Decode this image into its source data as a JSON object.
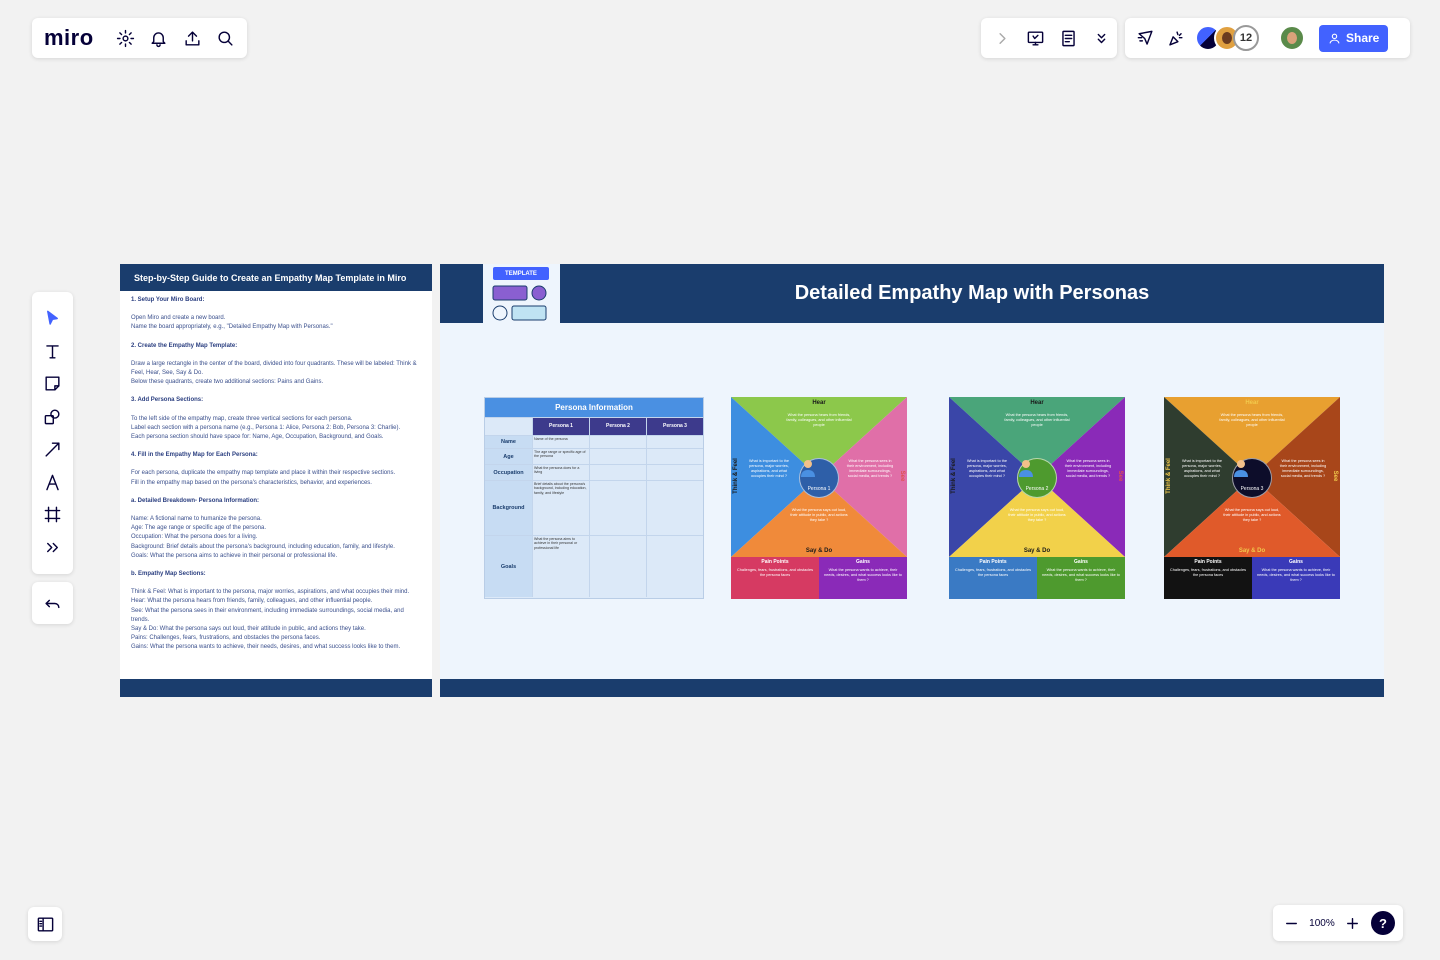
{
  "app": {
    "logo": "miro"
  },
  "toolbar_right": {
    "share_label": "Share",
    "collaborator_count": "12"
  },
  "zoom": {
    "value": "100%",
    "help": "?"
  },
  "guide": {
    "title": "Step-by-Step Guide to Create an Empathy Map Template in Miro",
    "sections": [
      {
        "heading": "1. Setup Your Miro Board:",
        "lines": [
          "Open Miro and create a new board.",
          "Name the board appropriately, e.g., \"Detailed Empathy Map with Personas.\""
        ]
      },
      {
        "heading": "2. Create the Empathy Map Template:",
        "lines": [
          "Draw a large rectangle in the center of the board, divided into four quadrants. These will be labeled: Think & Feel, Hear, See, Say & Do.",
          "Below these quadrants, create two additional sections: Pains and Gains."
        ]
      },
      {
        "heading": "3. Add Persona Sections:",
        "lines": [
          "To the left side of the empathy map, create three vertical sections for each persona.",
          "Label each section with a persona name (e.g., Persona 1: Alice, Persona 2: Bob, Persona 3: Charlie).",
          "Each persona section should have space for: Name, Age, Occupation, Background, and Goals."
        ]
      },
      {
        "heading": "4. Fill in the Empathy Map for Each Persona:",
        "lines": [
          "For each persona, duplicate the empathy map template and place it within their respective sections.",
          "Fill in the empathy map based on the persona's characteristics, behavior, and experiences."
        ]
      },
      {
        "heading": "a. Detailed Breakdown- Persona Information:",
        "lines": [
          "Name: A fictional name to humanize the persona.",
          "Age: The age range or specific age of the persona.",
          "Occupation: What the persona does for a living.",
          "Background: Brief details about the persona's background, including education, family, and lifestyle.",
          "Goals: What the persona aims to achieve in their personal or professional life."
        ]
      },
      {
        "heading": "b. Empathy Map Sections:",
        "lines": [
          "Think & Feel: What is important to the persona, major worries, aspirations, and what occupies their mind.",
          "Hear: What the persona hears from friends, family, colleagues, and other influential people.",
          "See: What the persona sees in their environment, including immediate surroundings, social media, and trends.",
          "Say & Do: What the persona says out loud, their attitude in public, and actions they take.",
          "Pains: Challenges, fears, frustrations, and obstacles the persona faces.",
          "Gains: What the persona wants to achieve, their needs, desires, and what success looks like to them."
        ]
      }
    ]
  },
  "main": {
    "title": "Detailed Empathy Map with Personas",
    "template_label": "TEMPLATE"
  },
  "persona_table": {
    "title": "Persona Information",
    "headers": [
      "Persona 1",
      "Persona 2",
      "Persona 3"
    ],
    "rows": [
      {
        "label": "Name",
        "text": "Name of the persona"
      },
      {
        "label": "Age",
        "text": "The age range or specific age of the persona"
      },
      {
        "label": "Occupation",
        "text": "What the persona does for a living"
      },
      {
        "label": "Background",
        "text": "Brief details about the persona's background, including education, family, and lifestyle"
      },
      {
        "label": "Goals",
        "text": "What the persona aims to achieve in their personal or professional life"
      }
    ]
  },
  "empathy": {
    "labels": {
      "hear": "Hear",
      "think": "Think & Feel",
      "see": "See",
      "say": "Say & Do",
      "pains": "Pain Points",
      "gains": "Gains"
    },
    "texts": {
      "hear": "What the persona hears from friends, family, colleagues, and other influential people",
      "think": "What is important to the persona, major worries, aspirations, and what occupies their mind ?",
      "see": "What the persona sees in their environment, including immediate surroundings, social media, and trends ?",
      "say": "What the persona says out loud, their attitude in public, and actions they take ?",
      "pains": "Challenges, fears, frustrations, and obstacles the persona faces",
      "gains": "What the persona wants to achieve, their needs, desires, and what success looks like to them ?"
    },
    "maps": [
      {
        "persona": "Persona 1",
        "colors": {
          "hear": "#8cc84b",
          "think": "#3d8ee0",
          "see": "#e06fa8",
          "say": "#f08a3a",
          "center": "#2e5fa8",
          "pains": "#d63a62",
          "gains": "#8a2ab8",
          "labeltxt": "#1a1a1a"
        }
      },
      {
        "persona": "Persona 2",
        "colors": {
          "hear": "#4aa57a",
          "think": "#3a46a8",
          "see": "#8a2ab8",
          "say": "#f2d14a",
          "center": "#4e9a2e",
          "pains": "#3a7ac4",
          "gains": "#4e9a2e",
          "labeltxt": "#1a1a1a"
        }
      },
      {
        "persona": "Persona 3",
        "colors": {
          "hear": "#e8a030",
          "think": "#2f3d2f",
          "see": "#a8461a",
          "say": "#e05a2a",
          "center": "#0d0d2a",
          "pains": "#121212",
          "gains": "#3a3ab8",
          "labeltxt": "#f2c94c"
        }
      }
    ]
  }
}
